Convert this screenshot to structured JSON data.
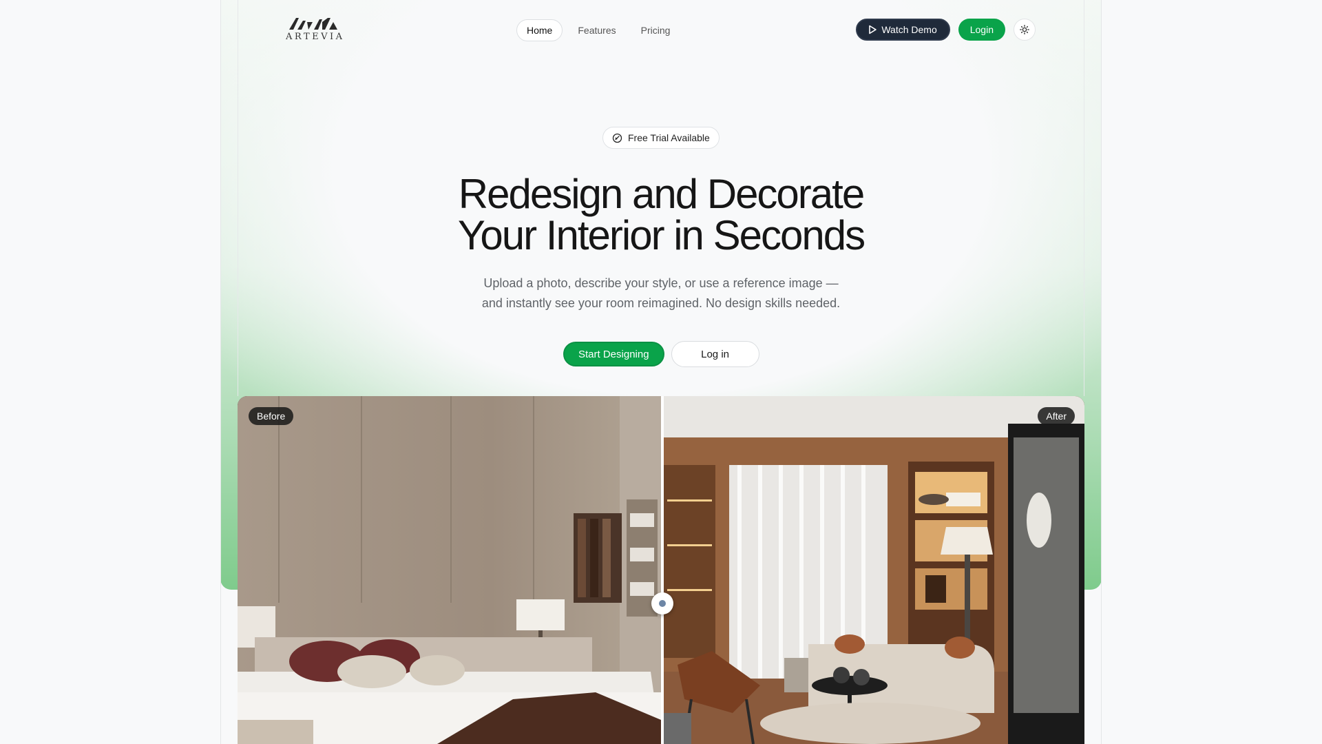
{
  "brand": {
    "name": "ARTEVIA"
  },
  "nav": {
    "items": [
      {
        "label": "Home",
        "active": true
      },
      {
        "label": "Features",
        "active": false
      },
      {
        "label": "Pricing",
        "active": false
      }
    ]
  },
  "actions": {
    "watch_demo": "Watch Demo",
    "login": "Login",
    "theme_icon": "sun-icon"
  },
  "hero": {
    "badge": "Free Trial Available",
    "headline_line1": "Redesign and Decorate",
    "headline_line2": "Your Interior in Seconds",
    "subtext_line1": "Upload a photo, describe your style, or use a reference image —",
    "subtext_line2": "and instantly see your room reimagined. No design skills needed.",
    "cta_primary": "Start Designing",
    "cta_secondary": "Log in"
  },
  "compare": {
    "before_label": "Before",
    "after_label": "After"
  },
  "colors": {
    "accent": "#0aa34a",
    "dark_button": "#1f2a3a",
    "background": "#f8f9fa"
  }
}
